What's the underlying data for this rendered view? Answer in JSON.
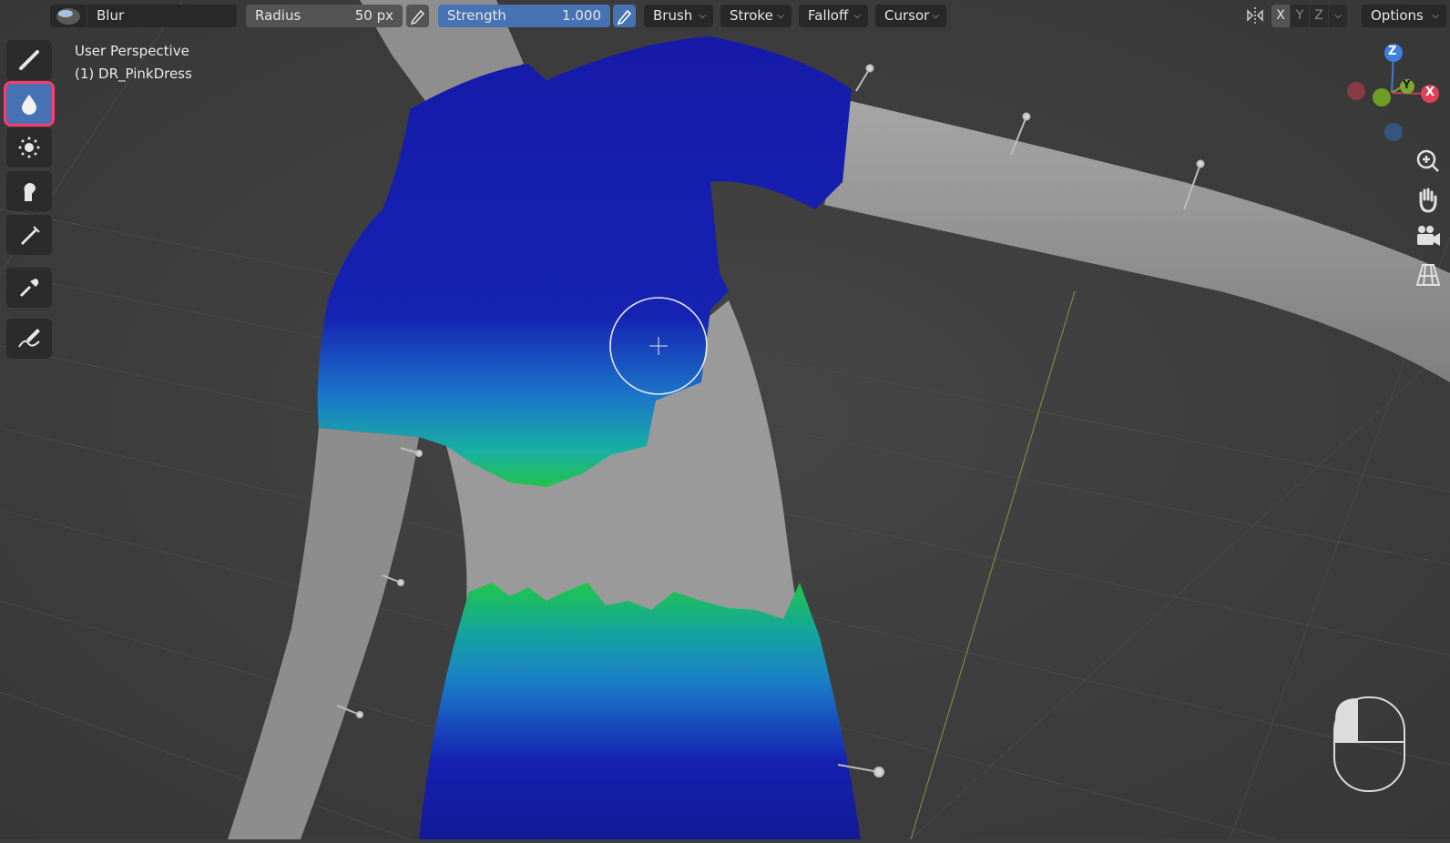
{
  "header": {
    "brush_name": "Blur",
    "radius_label": "Radius",
    "radius_value": "50 px",
    "strength_label": "Strength",
    "strength_value": "1.000",
    "menus": [
      "Brush",
      "Stroke",
      "Falloff",
      "Cursor"
    ],
    "axes": [
      "X",
      "Y",
      "Z"
    ],
    "options_label": "Options"
  },
  "viewport": {
    "perspective_label": "User Perspective",
    "object_label": "(1) DR_PinkDress"
  },
  "gizmo": {
    "z": "Z",
    "y": "Y",
    "x": "X"
  },
  "toolbar": {
    "tools": [
      "draw-tool",
      "blur-tool",
      "average-tool",
      "smear-tool",
      "sample-tool",
      "eyedropper-tool",
      "annotate-tool"
    ],
    "active_tool": "blur-tool"
  },
  "colors": {
    "accent": "#4772b3",
    "highlight_outline": "#ff3a6e",
    "paint_blue": "#1418a8",
    "paint_green": "#22c44a",
    "paint_cyan": "#19a7c9",
    "mesh_gray": "#9b9b9b"
  }
}
